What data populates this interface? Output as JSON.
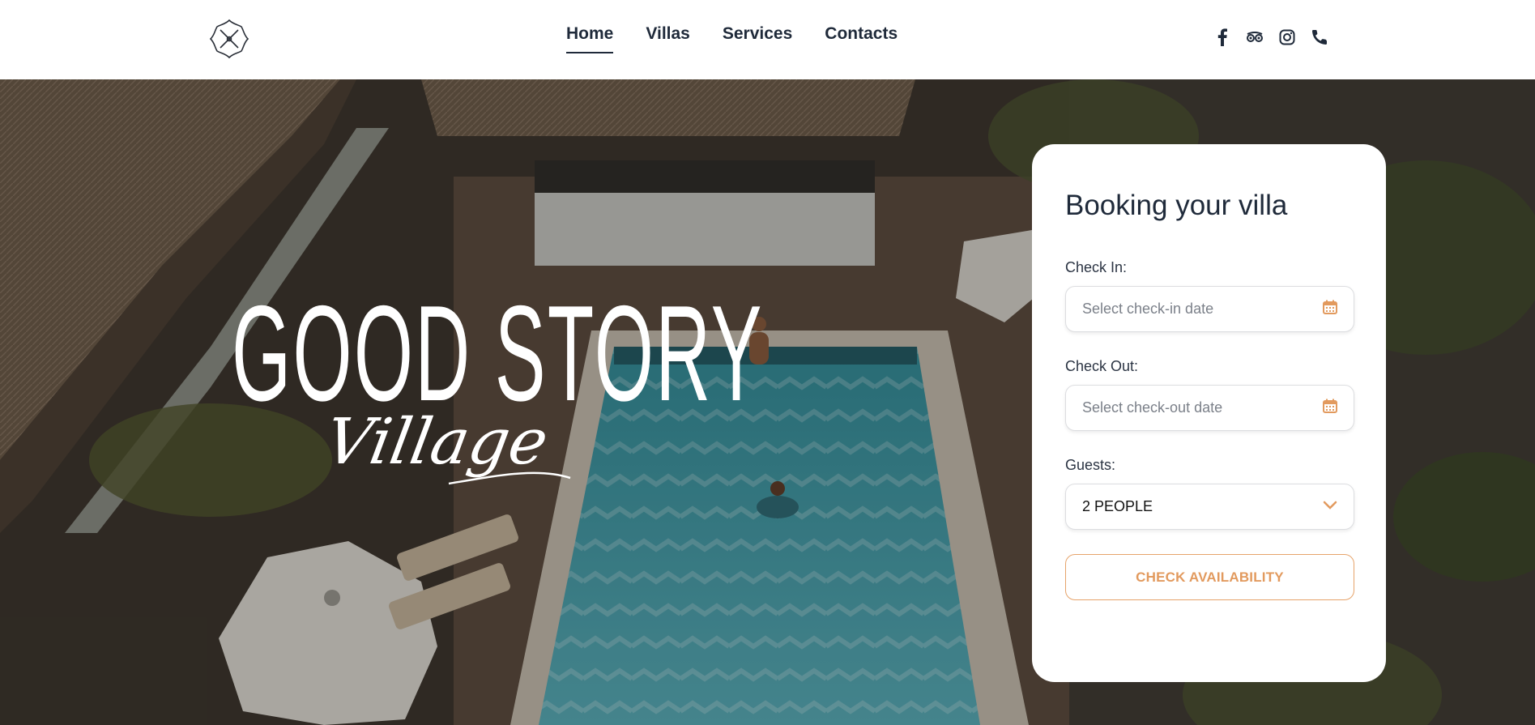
{
  "header": {
    "logo_icon": "crossed-keys-emblem-icon",
    "nav": [
      {
        "label": "Home",
        "active": true
      },
      {
        "label": "Villas",
        "active": false
      },
      {
        "label": "Services",
        "active": false
      },
      {
        "label": "Contacts",
        "active": false
      }
    ],
    "social_icons": [
      "facebook-icon",
      "tripadvisor-icon",
      "instagram-icon",
      "phone-icon"
    ]
  },
  "hero": {
    "title": "GOOD STORY",
    "subtitle_script": "Village",
    "background": "aerial photo of resort pool with thatched huts, palms, loungers and umbrellas"
  },
  "booking": {
    "title": "Booking your villa",
    "check_in_label": "Check In:",
    "check_in_placeholder": "Select check-in date",
    "check_out_label": "Check Out:",
    "check_out_placeholder": "Select check-out date",
    "guests_label": "Guests:",
    "guests_value": "2 PEOPLE",
    "cta_label": "CHECK AVAILABILITY"
  },
  "colors": {
    "accent": "#e29a5e",
    "nav_text": "#1f2a3a",
    "pool": "#3aa3b3"
  }
}
